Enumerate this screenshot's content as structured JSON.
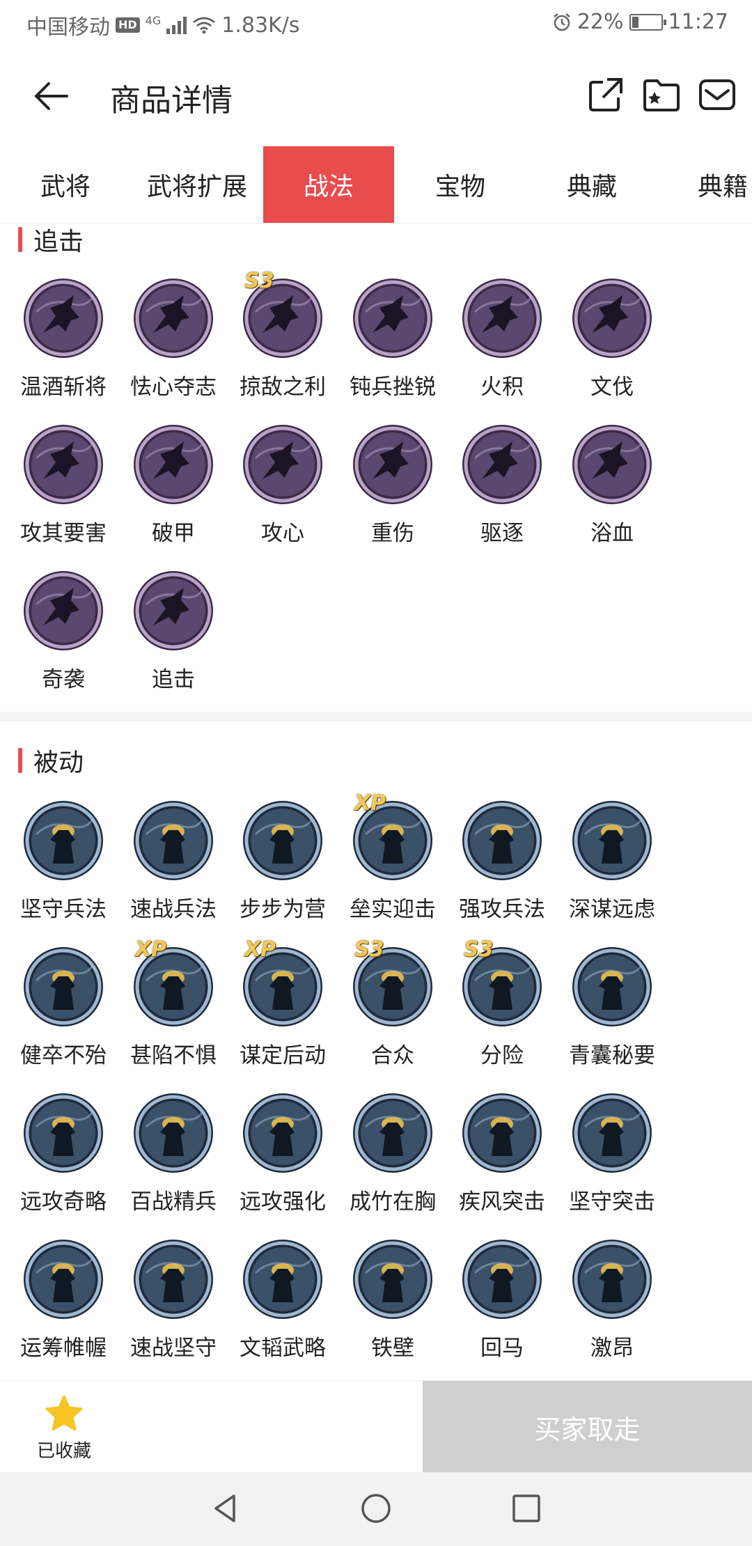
{
  "status": {
    "carrier": "中国移动",
    "hd": "HD",
    "network": "4G",
    "speed": "1.83K/s",
    "battery": "22%",
    "time": "11:27"
  },
  "header": {
    "title": "商品详情"
  },
  "tabs": [
    {
      "label": "武将",
      "active": false
    },
    {
      "label": "武将扩展",
      "active": false
    },
    {
      "label": "战法",
      "active": true
    },
    {
      "label": "宝物",
      "active": false
    },
    {
      "label": "典藏",
      "active": false
    },
    {
      "label": "典籍",
      "active": false
    }
  ],
  "sections": [
    {
      "title": "追击",
      "icon": "pursuit-skill-icon",
      "items": [
        {
          "label": "温酒斩将",
          "badge": ""
        },
        {
          "label": "怯心夺志",
          "badge": ""
        },
        {
          "label": "掠敌之利",
          "badge": "S3"
        },
        {
          "label": "钝兵挫锐",
          "badge": ""
        },
        {
          "label": "火积",
          "badge": ""
        },
        {
          "label": "文伐",
          "badge": ""
        },
        {
          "label": "攻其要害",
          "badge": ""
        },
        {
          "label": "破甲",
          "badge": ""
        },
        {
          "label": "攻心",
          "badge": ""
        },
        {
          "label": "重伤",
          "badge": ""
        },
        {
          "label": "驱逐",
          "badge": ""
        },
        {
          "label": "浴血",
          "badge": ""
        },
        {
          "label": "奇袭",
          "badge": ""
        },
        {
          "label": "追击",
          "badge": ""
        }
      ]
    },
    {
      "title": "被动",
      "icon": "passive-skill-icon",
      "items": [
        {
          "label": "坚守兵法",
          "badge": ""
        },
        {
          "label": "速战兵法",
          "badge": ""
        },
        {
          "label": "步步为营",
          "badge": ""
        },
        {
          "label": "垒实迎击",
          "badge": "XP"
        },
        {
          "label": "强攻兵法",
          "badge": ""
        },
        {
          "label": "深谋远虑",
          "badge": ""
        },
        {
          "label": "健卒不殆",
          "badge": ""
        },
        {
          "label": "甚陷不惧",
          "badge": "XP"
        },
        {
          "label": "谋定后动",
          "badge": "XP"
        },
        {
          "label": "合众",
          "badge": "S3"
        },
        {
          "label": "分险",
          "badge": "S3"
        },
        {
          "label": "青囊秘要",
          "badge": ""
        },
        {
          "label": "远攻奇略",
          "badge": ""
        },
        {
          "label": "百战精兵",
          "badge": ""
        },
        {
          "label": "远攻强化",
          "badge": ""
        },
        {
          "label": "成竹在胸",
          "badge": ""
        },
        {
          "label": "疾风突击",
          "badge": ""
        },
        {
          "label": "坚守突击",
          "badge": ""
        },
        {
          "label": "运筹帷幄",
          "badge": ""
        },
        {
          "label": "速战坚守",
          "badge": ""
        },
        {
          "label": "文韬武略",
          "badge": ""
        },
        {
          "label": "铁壁",
          "badge": ""
        },
        {
          "label": "回马",
          "badge": ""
        },
        {
          "label": "激昂",
          "badge": ""
        }
      ]
    }
  ],
  "footer": {
    "favorite_label": "已收藏",
    "buy_label": "买家取走"
  },
  "colors": {
    "accent": "#e84c4d",
    "star": "#f7c325",
    "disabled": "#cfcfcf"
  }
}
